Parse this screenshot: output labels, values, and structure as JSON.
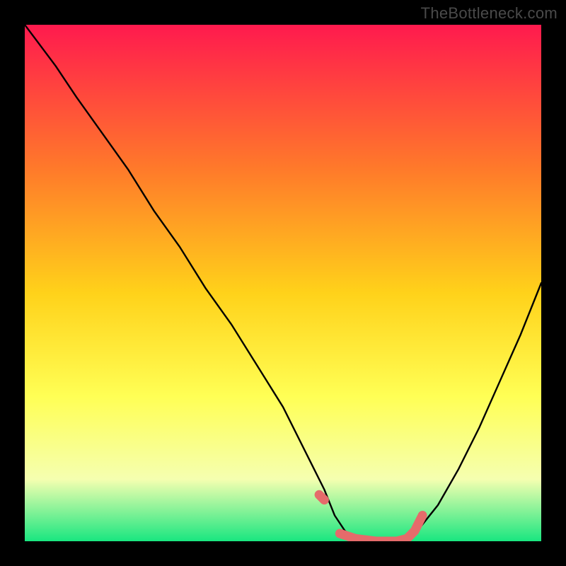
{
  "watermark": "TheBottleneck.com",
  "colors": {
    "background": "#000000",
    "gradient_top": "#ff1a4e",
    "gradient_mid1": "#ff7a2a",
    "gradient_mid2": "#ffd21a",
    "gradient_mid3": "#ffff55",
    "gradient_mid4": "#f5ffb0",
    "gradient_bottom": "#19e680",
    "curve": "#000000",
    "highlight": "#e56b6b"
  },
  "chart_data": {
    "type": "line",
    "title": "",
    "xlabel": "",
    "ylabel": "",
    "xlim": [
      0,
      100
    ],
    "ylim": [
      0,
      100
    ],
    "series": [
      {
        "name": "bottleneck-curve",
        "x": [
          0,
          3,
          6,
          10,
          15,
          20,
          25,
          30,
          35,
          40,
          45,
          50,
          55,
          58,
          60,
          62,
          65,
          68,
          72,
          76,
          80,
          84,
          88,
          92,
          96,
          100
        ],
        "y": [
          100,
          96,
          92,
          86,
          79,
          72,
          64,
          57,
          49,
          42,
          34,
          26,
          16,
          10,
          5,
          2,
          0,
          0,
          0,
          2,
          7,
          14,
          22,
          31,
          40,
          50
        ]
      }
    ],
    "highlight_segments": [
      {
        "name": "left-dot",
        "x": [
          57,
          58
        ],
        "y": [
          9,
          8
        ]
      },
      {
        "name": "valley",
        "x": [
          61,
          64,
          68,
          72,
          74,
          75.5,
          77
        ],
        "y": [
          1.5,
          0.5,
          0,
          0,
          0.5,
          2,
          5
        ]
      }
    ]
  }
}
